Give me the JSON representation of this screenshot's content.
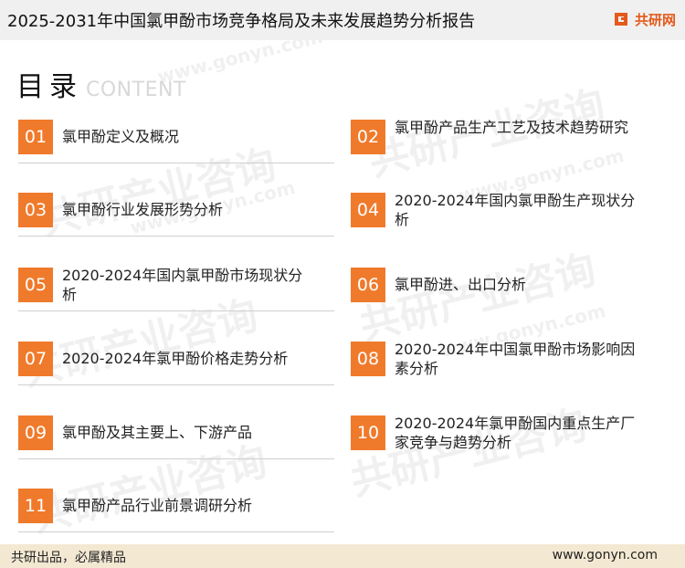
{
  "header": {
    "title": "2025-2031年中国氯甲酚市场竞争格局及未来发展趋势分析报告",
    "brand": "共研网"
  },
  "toc": {
    "heading_cn": "目录",
    "heading_en": "CONTENT",
    "items": [
      {
        "num": "01",
        "label": "氯甲酚定义及概况"
      },
      {
        "num": "02",
        "label": "氯甲酚产品生产工艺及技术趋势研究"
      },
      {
        "num": "03",
        "label": "氯甲酚行业发展形势分析"
      },
      {
        "num": "04",
        "label": "2020-2024年国内氯甲酚生产现状分析"
      },
      {
        "num": "05",
        "label": "2020-2024年国内氯甲酚市场现状分析"
      },
      {
        "num": "06",
        "label": "氯甲酚进、出口分析"
      },
      {
        "num": "07",
        "label": "2020-2024年氯甲酚价格走势分析"
      },
      {
        "num": "08",
        "label": "2020-2024年中国氯甲酚市场影响因素分析"
      },
      {
        "num": "09",
        "label": "氯甲酚及其主要上、下游产品"
      },
      {
        "num": "10",
        "label": "2020-2024年氯甲酚国内重点生产厂家竞争与趋势分析"
      },
      {
        "num": "11",
        "label": "氯甲酚产品行业前景调研分析"
      }
    ]
  },
  "watermark": {
    "text": "共研产业咨询",
    "url_text": "www.gonyn.com",
    "color": "#000000"
  },
  "footer": {
    "slogan": "共研出品，必属精品",
    "site": "www.gonyn.com"
  },
  "colors": {
    "accent": "#f07a2b",
    "brand": "#e35a1c",
    "footer_bg": "#f3e8d2",
    "header_bg": "#f0f0f0"
  }
}
